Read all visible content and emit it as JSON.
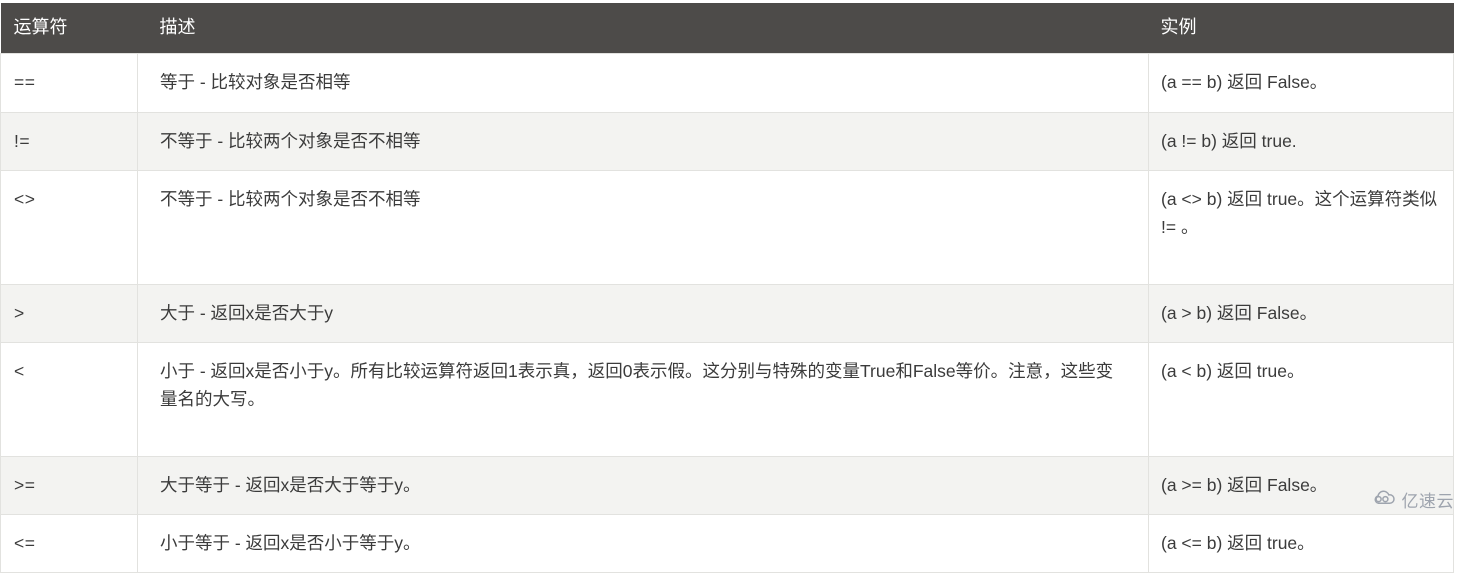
{
  "table": {
    "columns": [
      {
        "key": "operator",
        "label": "运算符"
      },
      {
        "key": "description",
        "label": "描述"
      },
      {
        "key": "example",
        "label": "实例"
      }
    ],
    "header_bg": "#4d4b49",
    "header_color": "#ffffff",
    "row_alt_bg": "#f3f3f1",
    "row_bg": "#ffffff",
    "border_color": "#e2e2df",
    "rows": [
      {
        "operator": "==",
        "description": "等于 - 比较对象是否相等",
        "example": "(a == b) 返回 False。"
      },
      {
        "operator": "!=",
        "description": "不等于 - 比较两个对象是否不相等",
        "example": "(a != b) 返回 true."
      },
      {
        "operator": "<>",
        "description": "不等于 - 比较两个对象是否不相等",
        "example": "(a <> b) 返回 true。这个运算符类似 != 。"
      },
      {
        "operator": ">",
        "description": "大于 - 返回x是否大于y",
        "example": "(a > b) 返回 False。"
      },
      {
        "operator": "<",
        "description": "小于 - 返回x是否小于y。所有比较运算符返回1表示真，返回0表示假。这分别与特殊的变量True和False等价。注意，这些变量名的大写。",
        "example": "(a < b) 返回 true。"
      },
      {
        "operator": ">=",
        "description": "大于等于 - 返回x是否大于等于y。",
        "example": "(a >= b) 返回 False。"
      },
      {
        "operator": "<=",
        "description": "小于等于 - 返回x是否小于等于y。",
        "example": "(a <= b) 返回 true。"
      }
    ]
  },
  "watermark": {
    "text": "亿速云",
    "icon": "cloud-icon",
    "color": "#9aa0ab"
  }
}
